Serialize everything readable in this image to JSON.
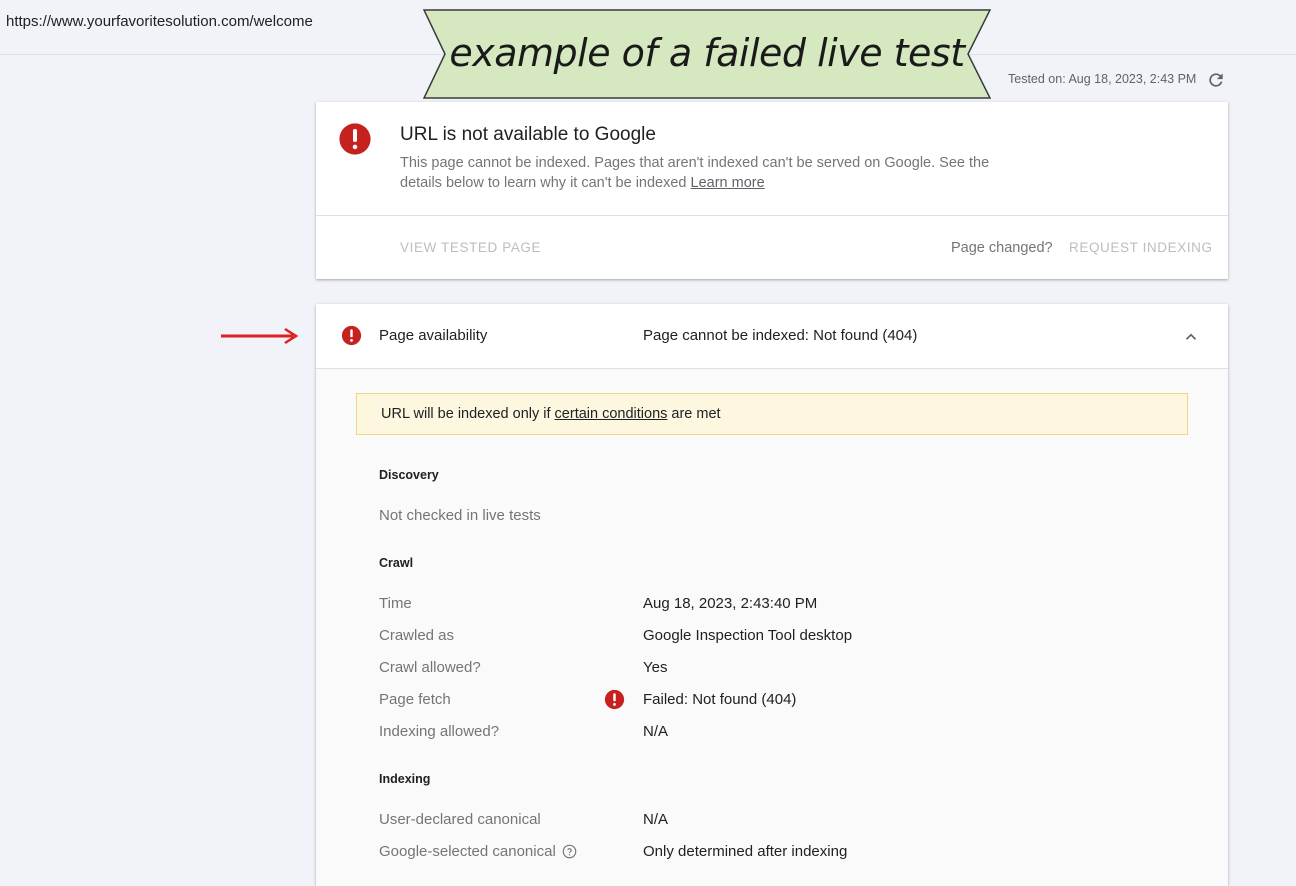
{
  "address_bar": {
    "url": "https://www.yourfavoritesolution.com/welcome"
  },
  "banner": {
    "text": "example of a failed live test"
  },
  "header": {
    "tested_on": "Tested on: Aug 18, 2023, 2:43 PM",
    "refresh_icon": "refresh-icon"
  },
  "summary_card": {
    "title": "URL is not available to Google",
    "description": "This page cannot be indexed. Pages that aren't indexed can't be served on Google. See the details below to learn why it can't be indexed",
    "learn_more": "Learn more",
    "view_tested_page": "VIEW TESTED PAGE",
    "page_changed": "Page changed?",
    "request_indexing": "REQUEST INDEXING",
    "error_icon": "error-icon"
  },
  "availability": {
    "name": "Page availability",
    "status": "Page cannot be indexed: Not found (404)",
    "notice_prefix": "URL will be indexed only if ",
    "notice_link": "certain conditions",
    "notice_suffix": " are met",
    "discovery": {
      "heading": "Discovery",
      "text": "Not checked in live tests"
    },
    "crawl": {
      "heading": "Crawl",
      "rows": [
        {
          "label": "Time",
          "value": "Aug 18, 2023, 2:43:40 PM"
        },
        {
          "label": "Crawled as",
          "value": "Google Inspection Tool desktop"
        },
        {
          "label": "Crawl allowed?",
          "value": "Yes"
        },
        {
          "label": "Page fetch",
          "value": "Failed: Not found (404)"
        },
        {
          "label": "Indexing allowed?",
          "value": "N/A"
        }
      ]
    },
    "indexing": {
      "heading": "Indexing",
      "rows": [
        {
          "label": "User-declared canonical",
          "value": "N/A"
        },
        {
          "label": "Google-selected canonical",
          "value": "Only determined after indexing"
        }
      ]
    }
  },
  "colors": {
    "error": "#c5221f",
    "notice_bg": "#fef7e0",
    "arrow": "#e02020",
    "banner_bg": "#d5e8bf"
  }
}
